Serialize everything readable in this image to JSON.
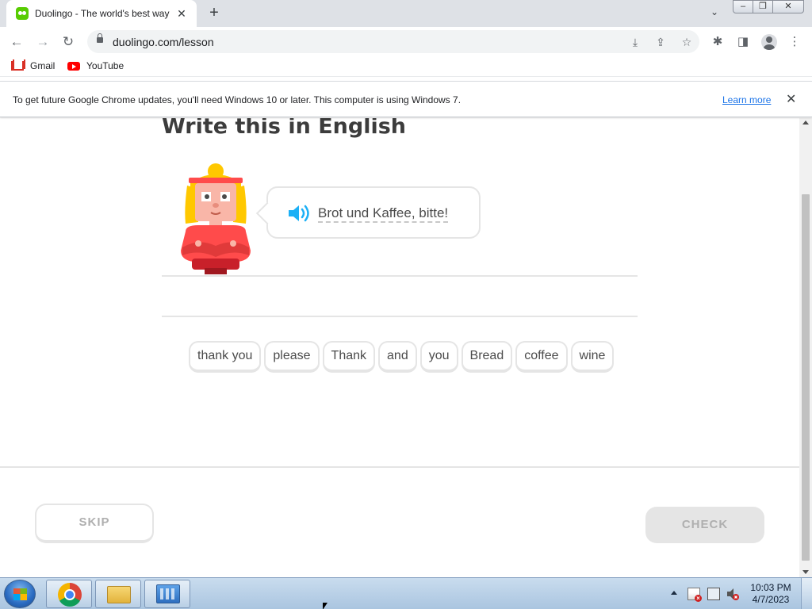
{
  "browser": {
    "tab_title": "Duolingo - The world's best way to learn a language",
    "tab_close": "✕",
    "new_tab": "+",
    "tab_search": "⌄",
    "window_buttons": {
      "minimize": "–",
      "maximize": "❐",
      "close": "✕"
    },
    "url": "duolingo.com/lesson",
    "back": "←",
    "forward": "→",
    "reload": "↻",
    "omnibox_icons": {
      "install": "⤓",
      "share": "⇪",
      "bookmark": "☆"
    },
    "toolbar_icons": {
      "extensions": "✱",
      "side_panel": "◨",
      "menu": "⋮"
    }
  },
  "bookmarks": [
    {
      "label": "Gmail",
      "icon": "gmail-icon"
    },
    {
      "label": "YouTube",
      "icon": "youtube-icon"
    }
  ],
  "infobar": {
    "message": "To get future Google Chrome updates, you'll need Windows 10 or later. This computer is using Windows 7.",
    "link": "Learn more",
    "close": "✕"
  },
  "lesson": {
    "heading": "Write this in English",
    "prompt": "Brot und Kaffee, bitte!",
    "words": [
      "thank you",
      "please",
      "Thank",
      "and",
      "you",
      "Bread",
      "coffee",
      "wine"
    ],
    "skip_label": "SKIP",
    "check_label": "CHECK"
  },
  "colors": {
    "heading": "#3c3c3c",
    "speaker": "#1cb0f6",
    "border": "#e5e5e5",
    "disabled_text": "#afafaf",
    "character_shirt": "#ff4b4b",
    "character_hair": "#ffc800"
  },
  "taskbar": {
    "time": "10:03 PM",
    "date": "4/7/2023",
    "apps": [
      "chrome-icon",
      "folder-icon",
      "app-icon"
    ]
  }
}
